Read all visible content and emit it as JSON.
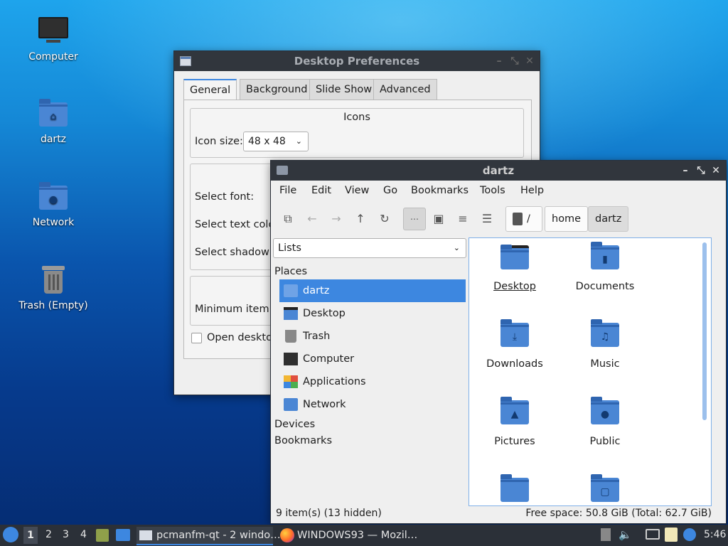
{
  "desktop": {
    "icons": [
      {
        "label": "Computer",
        "icon": "monitor-icon"
      },
      {
        "label": "dartz",
        "icon": "home-folder-icon"
      },
      {
        "label": "Network",
        "icon": "network-folder-icon"
      },
      {
        "label": "Trash (Empty)",
        "icon": "trash-icon"
      }
    ]
  },
  "prefs": {
    "title": "Desktop Preferences",
    "tabs": [
      "General",
      "Background",
      "Slide Show",
      "Advanced"
    ],
    "active_tab": "General",
    "icons_group": "Icons",
    "icon_size_label": "Icon size:",
    "icon_size_value": "48 x 48",
    "select_font": "Select font:",
    "select_text_color": "Select text colo",
    "select_shadow": "Select shadow c",
    "min_item": "Minimum item r",
    "open_desktop": "Open desktop"
  },
  "fm": {
    "title": "dartz",
    "menu": [
      "File",
      "Edit",
      "View",
      "Go",
      "Bookmarks",
      "Tools",
      "Help"
    ],
    "breadcrumbs": [
      "/",
      "home",
      "dartz"
    ],
    "view_select": "Lists",
    "places_header": "Places",
    "places": [
      {
        "label": "dartz",
        "icon": "home-icon",
        "selected": true
      },
      {
        "label": "Desktop",
        "icon": "desktop-icon",
        "selected": false
      },
      {
        "label": "Trash",
        "icon": "trash-icon",
        "selected": false
      },
      {
        "label": "Computer",
        "icon": "computer-icon",
        "selected": false
      },
      {
        "label": "Applications",
        "icon": "applications-icon",
        "selected": false
      },
      {
        "label": "Network",
        "icon": "network-icon",
        "selected": false
      }
    ],
    "devices_header": "Devices",
    "bookmarks_header": "Bookmarks",
    "items": [
      {
        "label": "Desktop",
        "icon": "desktop-folder-icon"
      },
      {
        "label": "Documents",
        "icon": "documents-folder-icon"
      },
      {
        "label": "Downloads",
        "icon": "downloads-folder-icon"
      },
      {
        "label": "Music",
        "icon": "music-folder-icon"
      },
      {
        "label": "Pictures",
        "icon": "pictures-folder-icon"
      },
      {
        "label": "Public",
        "icon": "public-folder-icon"
      },
      {
        "label": "",
        "icon": "folder-icon"
      },
      {
        "label": "",
        "icon": "templates-folder-icon"
      }
    ],
    "status_left": "9 item(s) (13 hidden)",
    "status_right": "Free space: 50.8 GiB (Total: 62.7 GiB)"
  },
  "taskbar": {
    "workspaces": [
      "1",
      "2",
      "3",
      "4"
    ],
    "active_workspace": "1",
    "tasks": [
      {
        "label": "pcmanfm-qt - 2 windo…",
        "icon": "window-icon"
      },
      {
        "label": "WINDOWS93 — Mozil…",
        "icon": "firefox-icon"
      }
    ],
    "clock": "5:46"
  }
}
